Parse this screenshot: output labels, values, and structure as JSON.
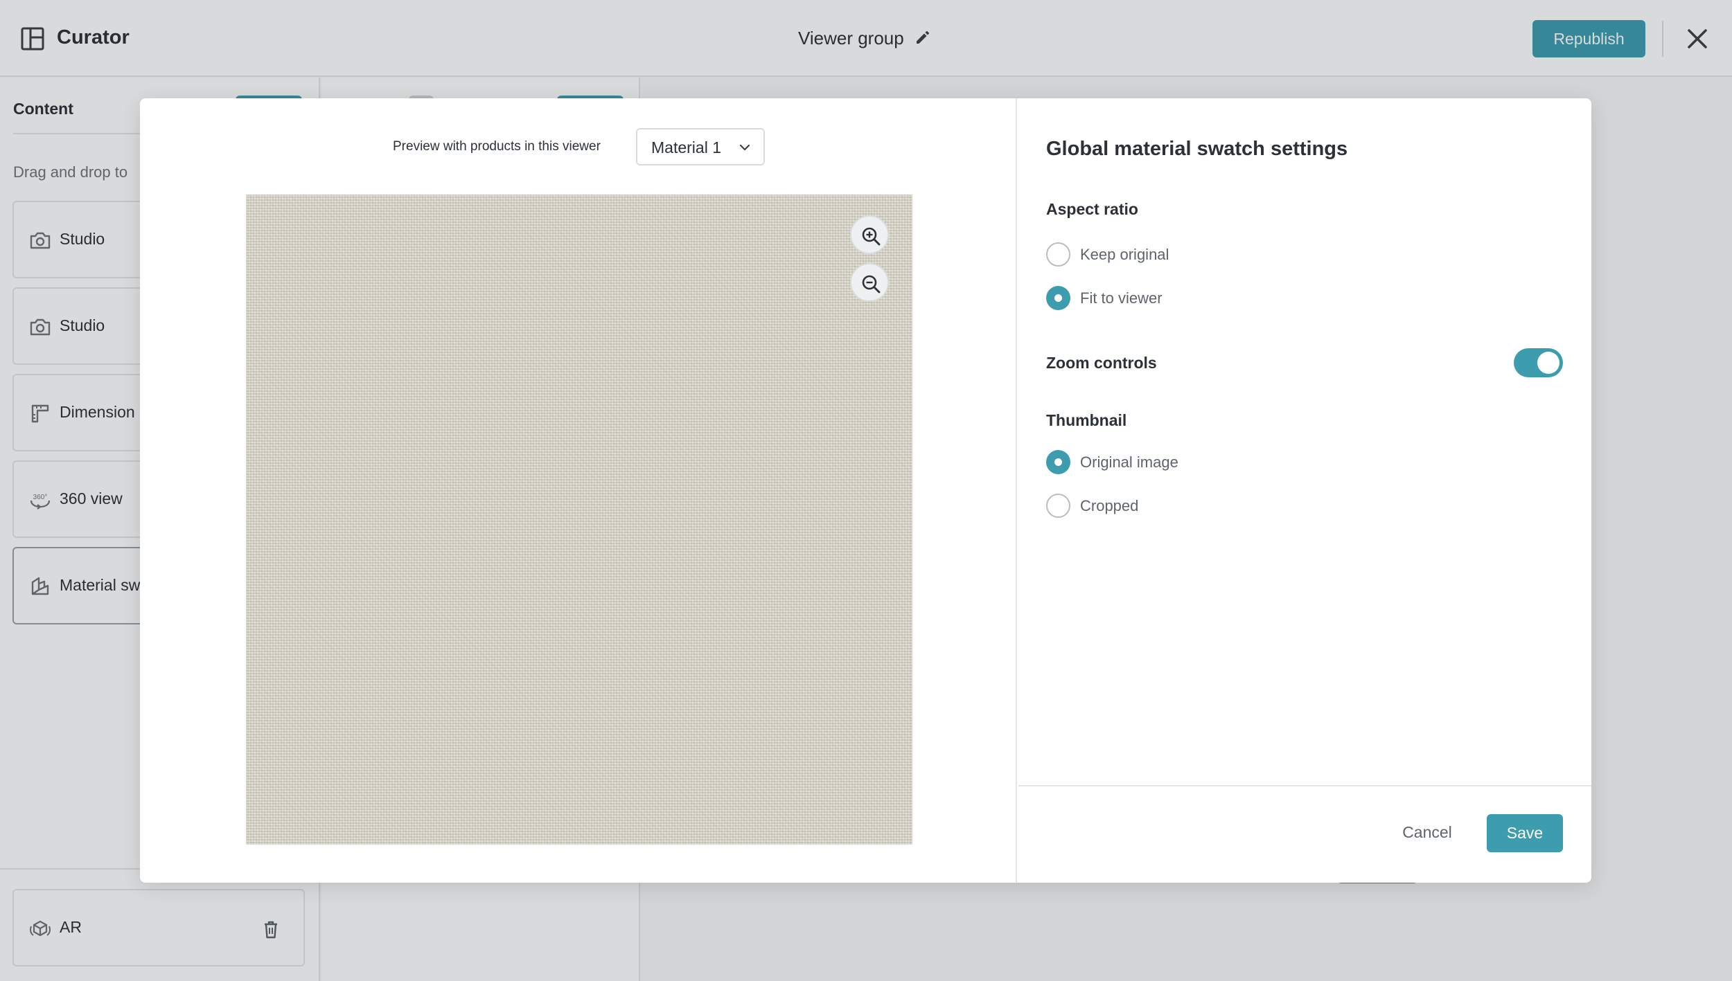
{
  "header": {
    "app_title": "Curator",
    "group_title": "Viewer group",
    "republish_label": "Republish"
  },
  "sidebar": {
    "heading": "Content",
    "hint": "Drag and drop to",
    "items": [
      {
        "label": "Studio",
        "icon": "camera-icon"
      },
      {
        "label": "Studio",
        "icon": "camera-icon"
      },
      {
        "label": "Dimension",
        "icon": "ruler-icon"
      },
      {
        "label": "360 view",
        "icon": "rotate-360-icon"
      },
      {
        "label": "Material sw",
        "icon": "material-swatch-icon"
      }
    ],
    "ar_item": {
      "label": "AR",
      "icon": "ar-icon"
    }
  },
  "modal": {
    "preview_label": "Preview with products in this viewer",
    "material_select": {
      "value": "Material 1"
    },
    "settings_title": "Global material swatch settings",
    "aspect_ratio": {
      "label": "Aspect ratio",
      "options": [
        {
          "label": "Keep original",
          "checked": false
        },
        {
          "label": "Fit to viewer",
          "checked": true
        }
      ]
    },
    "zoom_controls": {
      "label": "Zoom controls",
      "enabled": true
    },
    "thumbnail": {
      "label": "Thumbnail",
      "options": [
        {
          "label": "Original image",
          "checked": true
        },
        {
          "label": "Cropped",
          "checked": false
        }
      ]
    },
    "cancel_label": "Cancel",
    "save_label": "Save"
  },
  "colors": {
    "accent": "#3d9cae",
    "text": "#2b3137",
    "muted_text": "#5d646b",
    "border": "#e3e6e9",
    "swatch_fabric": "#d8d4c8"
  }
}
